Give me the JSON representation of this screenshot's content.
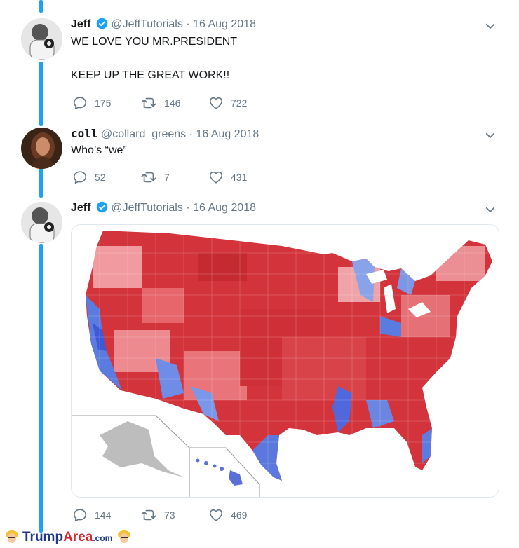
{
  "tweets": [
    {
      "name": "Jeff",
      "handle": "@JeffTutorials",
      "separator": "·",
      "date": "16 Aug 2018",
      "text_line1": "WE LOVE YOU MR.PRESIDENT",
      "text_line2": "KEEP UP THE GREAT WORK!!",
      "replies": "175",
      "retweets": "146",
      "likes": "722"
    },
    {
      "name": "coll",
      "handle": "@collard_greens",
      "separator": "·",
      "date": "16 Aug 2018",
      "text_line1": "Who’s “we”",
      "replies": "52",
      "retweets": "7",
      "likes": "431"
    },
    {
      "name": "Jeff",
      "handle": "@JeffTutorials",
      "separator": "·",
      "date": "16 Aug 2018",
      "replies": "144",
      "retweets": "73",
      "likes": "469"
    }
  ],
  "colors": {
    "thread": "#1da1f2",
    "verified": "#1da1f2",
    "muted": "#657786",
    "map_red": "#d3333a",
    "map_blue": "#5a7be0",
    "map_lightred": "#f19ba0"
  },
  "icons": {
    "reply": "reply-icon",
    "retweet": "retweet-icon",
    "like": "heart-icon",
    "more": "chevron-down-icon",
    "verified": "verified-badge-icon"
  },
  "watermark": {
    "part1": "Trump",
    "part2": "Area",
    "part3": ".com"
  }
}
